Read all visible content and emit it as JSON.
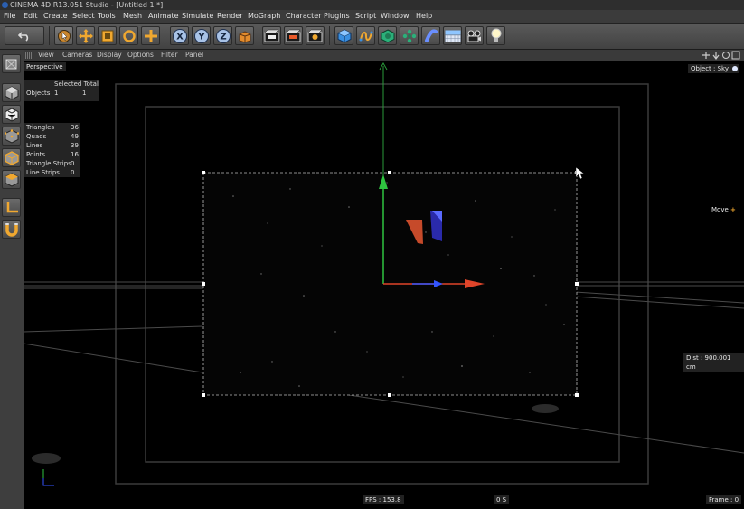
{
  "window": {
    "title": "CINEMA 4D R13.051 Studio - [Untitled 1 *]"
  },
  "menu": [
    "File",
    "Edit",
    "Create",
    "Select",
    "Tools",
    "Mesh",
    "Animate",
    "Simulate",
    "Render",
    "MoGraph",
    "Character",
    "Plugins",
    "Script",
    "Window",
    "Help"
  ],
  "toolbar": {
    "tools": [
      {
        "name": "undo-icon"
      },
      {
        "name": "live-selection-icon"
      },
      {
        "name": "move-icon"
      },
      {
        "name": "scale-icon"
      },
      {
        "name": "rotate-icon"
      },
      {
        "name": "recent-tool-icon"
      },
      {
        "name": "x-axis-lock",
        "label": "X"
      },
      {
        "name": "y-axis-lock",
        "label": "Y"
      },
      {
        "name": "z-axis-lock",
        "label": "Z"
      },
      {
        "name": "coordinate-system-icon"
      },
      {
        "name": "render-view-icon"
      },
      {
        "name": "render-picture-viewer-icon"
      },
      {
        "name": "render-settings-icon"
      },
      {
        "name": "cube-icon"
      },
      {
        "name": "spline-icon"
      },
      {
        "name": "nurbs-icon"
      },
      {
        "name": "array-icon"
      },
      {
        "name": "deformer-icon"
      },
      {
        "name": "floor-icon"
      },
      {
        "name": "camera-icon"
      },
      {
        "name": "light-icon"
      }
    ]
  },
  "left_tools": [
    "make-editable-icon",
    "model-mode-icon",
    "texture-mode-icon",
    "points-mode-icon",
    "edges-mode-icon",
    "polygons-mode-icon",
    "axis-mode-icon",
    "magnet-icon"
  ],
  "viewport_menu": [
    "View",
    "Cameras",
    "Display",
    "Options",
    "Filter",
    "Panel"
  ],
  "viewport": {
    "name": "Perspective",
    "selected_header": "Selected Total",
    "objects": {
      "label": "Objects",
      "selected": "1",
      "total": "1"
    },
    "stats": [
      {
        "label": "Triangles",
        "value": "36"
      },
      {
        "label": "Quads",
        "value": "49"
      },
      {
        "label": "Lines",
        "value": "39"
      },
      {
        "label": "Points",
        "value": "16"
      },
      {
        "label": "Triangle Strips",
        "value": "0"
      },
      {
        "label": "Line Strips",
        "value": "0"
      }
    ],
    "object_label": "Object : Sky",
    "move_label": "Move",
    "dist": "Dist : 900.001 cm",
    "fps": "FPS : 153.8",
    "time": "0 S",
    "frame": "Frame : 0"
  },
  "colors": {
    "x_axis": "#e0452a",
    "y_axis": "#2fc440",
    "z_axis": "#3355ff",
    "accent": "#e8a33a"
  }
}
